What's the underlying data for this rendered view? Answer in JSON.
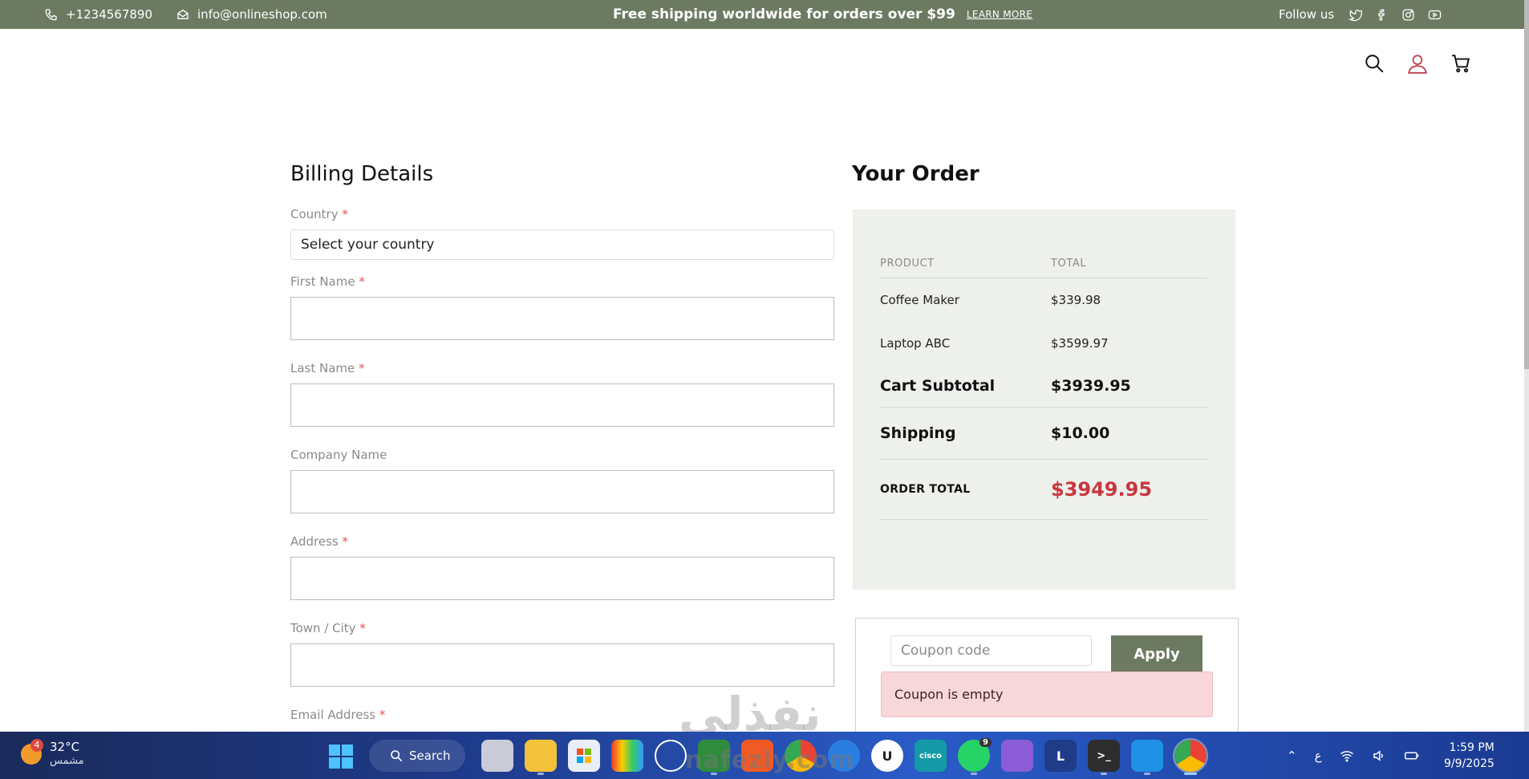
{
  "topbar": {
    "phone": "+1234567890",
    "email": "info@onlineshop.com",
    "shipping_msg": "Free shipping worldwide for orders over $99",
    "learn_more": "LEARN MORE",
    "follow_us": "Follow us",
    "social": [
      "twitter-icon",
      "facebook-icon",
      "instagram-icon",
      "youtube-icon"
    ]
  },
  "header": {
    "icons": [
      "search-icon",
      "user-icon",
      "cart-icon"
    ]
  },
  "billing": {
    "title": "Billing Details",
    "fields": {
      "country": {
        "label": "Country",
        "required": "*",
        "value": "Select your country"
      },
      "first_name": {
        "label": "First Name",
        "required": "*"
      },
      "last_name": {
        "label": "Last Name",
        "required": "*"
      },
      "company": {
        "label": "Company Name"
      },
      "address": {
        "label": "Address",
        "required": "*"
      },
      "city": {
        "label": "Town / City",
        "required": "*"
      },
      "email": {
        "label": "Email Address",
        "required": "*"
      }
    }
  },
  "order": {
    "title": "Your Order",
    "col_product": "PRODUCT",
    "col_total": "TOTAL",
    "items": [
      {
        "name": "Coffee Maker",
        "total": "$339.98"
      },
      {
        "name": "Laptop ABC",
        "total": "$3599.97"
      }
    ],
    "subtotal_label": "Cart Subtotal",
    "subtotal_value": "$3939.95",
    "shipping_label": "Shipping",
    "shipping_value": "$10.00",
    "total_label": "ORDER TOTAL",
    "total_value": "$3949.95"
  },
  "coupon": {
    "placeholder": "Coupon code",
    "apply_label": "Apply",
    "error": "Coupon is empty"
  },
  "watermark": {
    "arabic": "نفذلي",
    "latin": "nafezly.com"
  },
  "taskbar": {
    "temp": "32°C",
    "condition": "مشمس",
    "weather_badge": "4",
    "search_label": "Search",
    "whatsapp_count": "9",
    "lang": "ع",
    "time": "1:59 PM",
    "date": "9/9/2025"
  },
  "colors": {
    "brand_green": "#6d7a62",
    "total_red": "#c8373d",
    "panel_bg": "#eef0ec",
    "alert_bg": "#f8d7da"
  }
}
